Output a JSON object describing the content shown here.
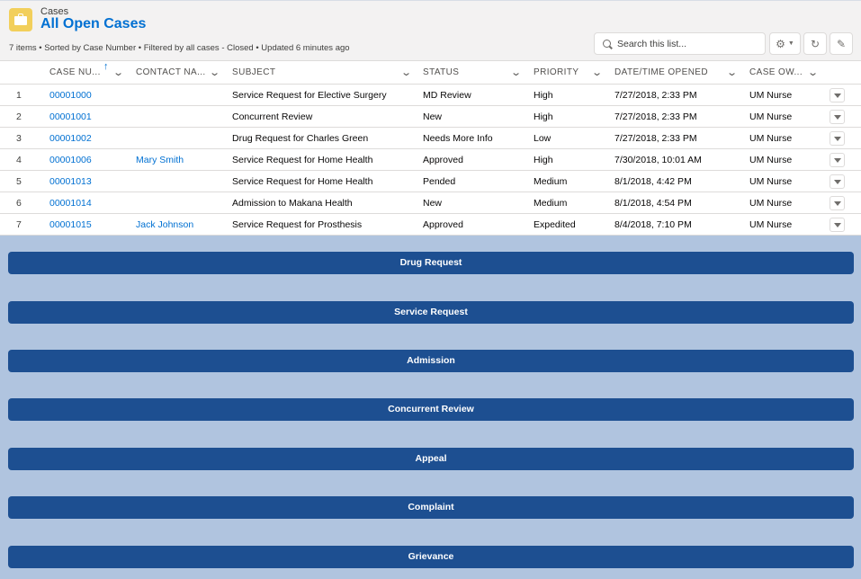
{
  "header": {
    "object_label": "Cases",
    "list_title": "All Open Cases",
    "meta": "7 items • Sorted by Case Number • Filtered by all cases - Closed • Updated 6 minutes ago",
    "search_placeholder": "Search this list..."
  },
  "columns": [
    "CASE NU...",
    "CONTACT NA...",
    "SUBJECT",
    "STATUS",
    "PRIORITY",
    "DATE/TIME OPENED",
    "CASE OW..."
  ],
  "rows": [
    {
      "n": "1",
      "case": "00001000",
      "contact": "",
      "subject": "Service Request for Elective Surgery",
      "status": "MD Review",
      "priority": "High",
      "opened": "7/27/2018, 2:33 PM",
      "owner": "UM Nurse"
    },
    {
      "n": "2",
      "case": "00001001",
      "contact": "",
      "subject": "Concurrent Review",
      "status": "New",
      "priority": "High",
      "opened": "7/27/2018, 2:33 PM",
      "owner": "UM Nurse"
    },
    {
      "n": "3",
      "case": "00001002",
      "contact": "",
      "subject": "Drug Request for Charles Green",
      "status": "Needs More Info",
      "priority": "Low",
      "opened": "7/27/2018, 2:33 PM",
      "owner": "UM Nurse"
    },
    {
      "n": "4",
      "case": "00001006",
      "contact": "Mary Smith",
      "subject": "Service Request for Home Health",
      "status": "Approved",
      "priority": "High",
      "opened": "7/30/2018, 10:01 AM",
      "owner": "UM Nurse"
    },
    {
      "n": "5",
      "case": "00001013",
      "contact": "",
      "subject": "Service Request for Home Health",
      "status": "Pended",
      "priority": "Medium",
      "opened": "8/1/2018, 4:42 PM",
      "owner": "UM Nurse"
    },
    {
      "n": "6",
      "case": "00001014",
      "contact": "",
      "subject": "Admission to Makana Health",
      "status": "New",
      "priority": "Medium",
      "opened": "8/1/2018, 4:54 PM",
      "owner": "UM Nurse"
    },
    {
      "n": "7",
      "case": "00001015",
      "contact": "Jack Johnson",
      "subject": "Service Request for Prosthesis",
      "status": "Approved",
      "priority": "Expedited",
      "opened": "8/4/2018, 7:10 PM",
      "owner": "UM Nurse"
    }
  ],
  "case_type_buttons": [
    "Drug Request",
    "Service Request",
    "Admission",
    "Concurrent Review",
    "Appeal",
    "Complaint",
    "Grievance"
  ],
  "colors": {
    "brand_blue": "#0070d2",
    "button_navy": "#1d4f91",
    "page_background": "#b0c4df",
    "case_icon": "#f2cf5b"
  }
}
